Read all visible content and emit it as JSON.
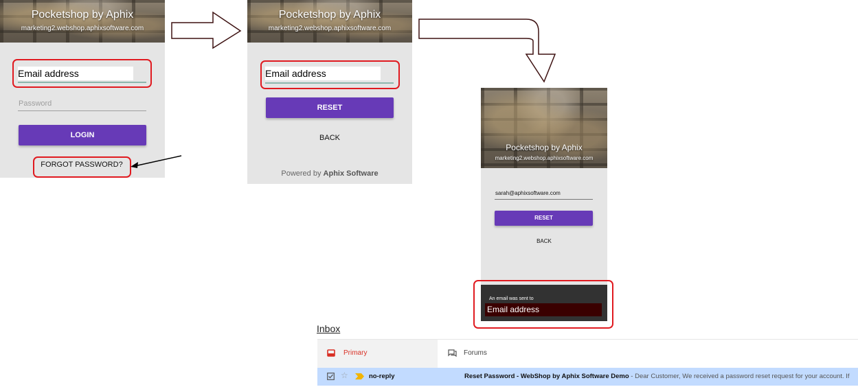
{
  "screen1": {
    "app_title": "Pocketshop by Aphix",
    "app_subtitle": "marketing2.webshop.aphixsoftware.com",
    "email_label": "Email address",
    "password_placeholder": "Password",
    "login_label": "LOGIN",
    "forgot_label": "FORGOT PASSWORD?"
  },
  "screen2": {
    "app_title": "Pocketshop by Aphix",
    "app_subtitle": "marketing2.webshop.aphixsoftware.com",
    "email_label": "Email address",
    "reset_label": "RESET",
    "back_label": "BACK",
    "powered_prefix": "Powered by ",
    "powered_brand": "Aphix Software"
  },
  "screen3": {
    "app_title": "Pocketshop by Aphix",
    "app_subtitle": "marketing2.webshop.aphixsoftware.com",
    "email_value": "sarah@aphixsoftware.com",
    "reset_label": "RESET",
    "back_label": "BACK",
    "toast_text": "An email was sent to",
    "toast_email": "Email address"
  },
  "inbox": {
    "heading": "Inbox",
    "tabs": [
      {
        "label": "Primary",
        "icon": "inbox-icon",
        "active": true
      },
      {
        "label": "Forums",
        "icon": "forum-icon",
        "active": false
      }
    ],
    "message": {
      "sender": "no-reply",
      "subject": "Reset Password - WebShop by Aphix Software Demo",
      "snippet": " - Dear Customer, We received a password reset request for your account. If"
    }
  },
  "colors": {
    "accent": "#673ab7",
    "highlight": "#e0191f",
    "gmail_red": "#d93025",
    "selected_row": "#c2dbff"
  }
}
